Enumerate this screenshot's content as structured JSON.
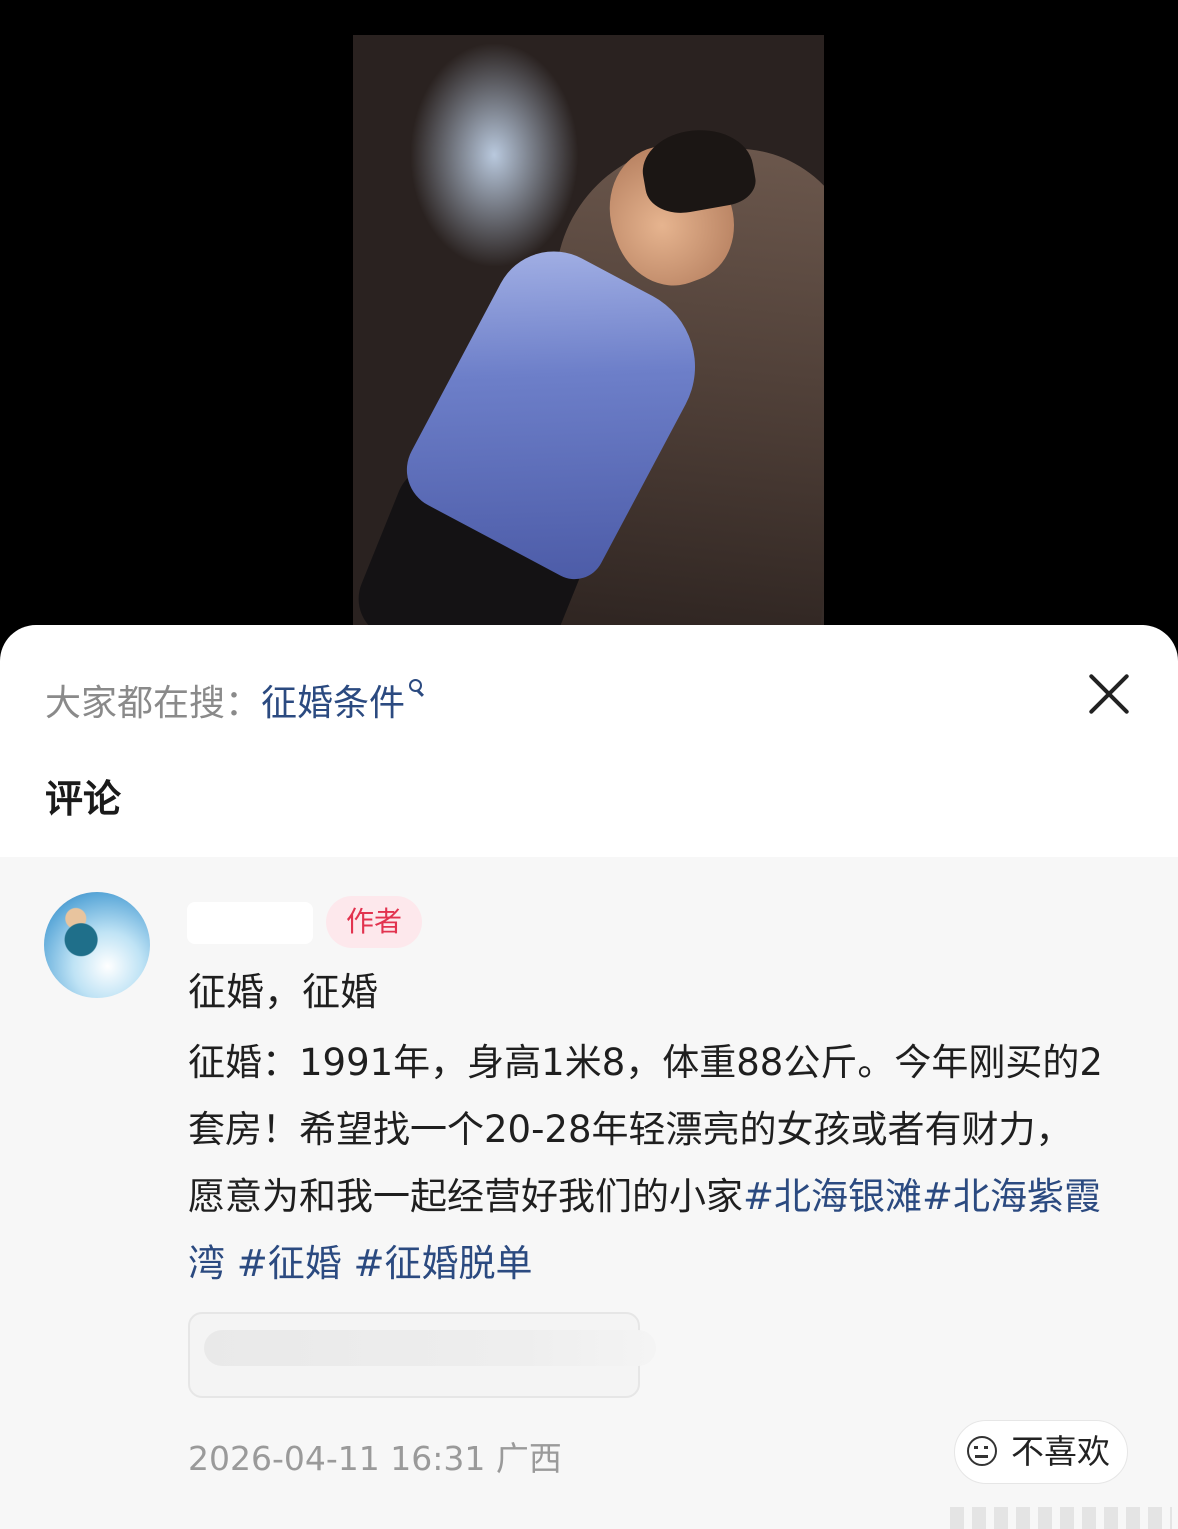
{
  "search": {
    "prefix": "大家都在搜：",
    "term": "征婚条件"
  },
  "section_title": "评论",
  "comment": {
    "author_badge": "作者",
    "first_line": "征婚，征婚",
    "body_text": "征婚：1991年，身高1米8，体重88公斤。今年刚买的2套房！希望找一个20-28年轻漂亮的女孩或者有财力，愿意为和我一起经营好我们的小家",
    "tags": [
      "#北海银滩",
      "#北海紫霞湾",
      "#征婚",
      "#征婚脱单"
    ],
    "timestamp": "2026-04-11 16:31",
    "location": "广西",
    "dislike_label": "不喜欢"
  },
  "icons": {
    "search": "search-icon",
    "close": "close-icon",
    "dislike": "unhappy-face-icon"
  },
  "colors": {
    "link": "#2b4a80",
    "badge_text": "#e2334f",
    "badge_bg": "#fde8ec"
  }
}
